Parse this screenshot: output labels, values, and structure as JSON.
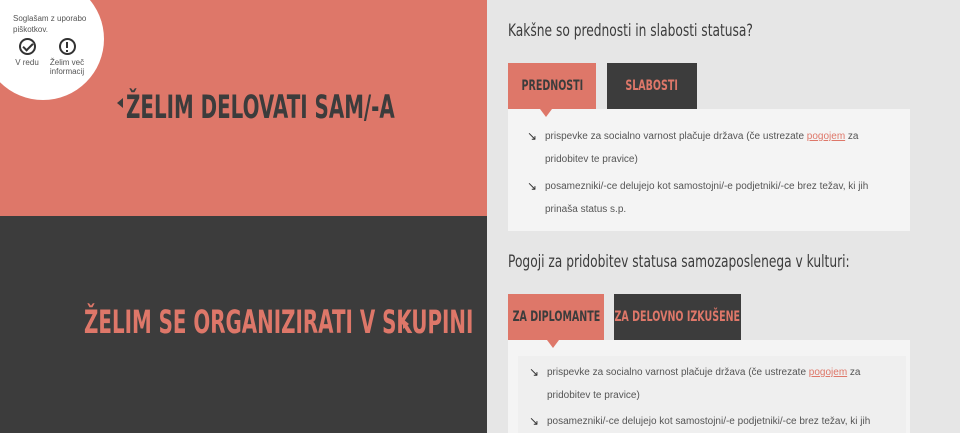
{
  "cookie": {
    "message": "Soglašam z uporabo piškotkov.",
    "accept_label": "V redu",
    "more_label": "Želim več informacij"
  },
  "left": {
    "top_title": "ŽELIM DELOVATI SAM/-A",
    "bottom_title": "ŽELIM SE ORGANIZIRATI V SKUPINI"
  },
  "section1": {
    "heading": "Kakšne so prednosti in slabosti statusa?",
    "tabs": [
      "PREDNOSTI",
      "SLABOSTI"
    ],
    "items": [
      {
        "before": "prispevke za socialno varnost plačuje država (če ustrezate ",
        "link": "pogojem",
        "after": " za pridobitev te pravice)"
      },
      {
        "text": "posamezniki/-ce delujejo kot samostojni/-e podjetniki/-ce brez težav, ki jih prinaša status s.p."
      }
    ]
  },
  "section2": {
    "heading": "Pogoji za pridobitev statusa samozaposlenega v kulturi:",
    "tabs": [
      "ZA DIPLOMANTE",
      "ZA DELOVNO IZKUŠENE"
    ],
    "items": [
      {
        "before": "prispevke za socialno varnost plačuje država (če ustrezate ",
        "link": "pogojem",
        "after": " za pridobitev te pravice)"
      },
      {
        "text": "posamezniki/-ce delujejo kot samostojni/-e podjetniki/-ce brez težav, ki jih"
      }
    ]
  },
  "colors": {
    "accent": "#de7769",
    "dark": "#3c3c3c",
    "panel": "#f4f4f4"
  }
}
